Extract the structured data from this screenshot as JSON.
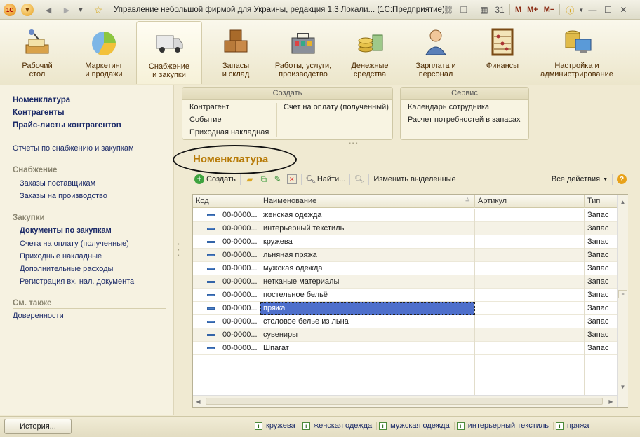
{
  "window": {
    "title": "Управление небольшой фирмой для Украины, редакция 1.3 Локали...  (1С:Предприятие)",
    "memory_buttons": [
      "M",
      "M+",
      "M−"
    ]
  },
  "sections": [
    {
      "label": "Рабочий\nстол",
      "icon": "desk-icon"
    },
    {
      "label": "Маркетинг\nи продажи",
      "icon": "pie-chart-icon"
    },
    {
      "label": "Снабжение\nи закупки",
      "icon": "truck-icon"
    },
    {
      "label": "Запасы\nи склад",
      "icon": "boxes-icon"
    },
    {
      "label": "Работы, услуги,\nпроизводство",
      "icon": "toolbox-icon"
    },
    {
      "label": "Денежные\nсредства",
      "icon": "coins-icon"
    },
    {
      "label": "Зарплата и\nперсонал",
      "icon": "person-icon"
    },
    {
      "label": "Финансы",
      "icon": "abacus-icon"
    },
    {
      "label": "Настройка и\nадминистрирование",
      "icon": "computer-icon"
    }
  ],
  "nav": {
    "top": [
      "Номенклатура",
      "Контрагенты",
      "Прайс-листы контрагентов"
    ],
    "reports": "Отчеты по снабжению и закупкам",
    "supply_header": "Снабжение",
    "supply": [
      "Заказы поставщикам",
      "Заказы на производство"
    ],
    "purchases_header": "Закупки",
    "purchases": [
      "Документы по закупкам",
      "Счета на оплату (полученные)",
      "Приходные накладные",
      "Дополнительные расходы",
      "Регистрация вх. нал. документа"
    ],
    "see_also_header": "См. также",
    "see_also": [
      "Доверенности"
    ]
  },
  "create_box": {
    "title": "Создать",
    "items": [
      "Контрагент",
      "Событие",
      "Приходная накладная",
      "Счет на оплату (полученный)"
    ]
  },
  "service_box": {
    "title": "Сервис",
    "items": [
      "Календарь сотрудника",
      "Расчет потребностей в запасах"
    ]
  },
  "form": {
    "title": "Номенклатура"
  },
  "toolbar": {
    "create": "Создать",
    "find": "Найти...",
    "change_selected": "Изменить выделенные",
    "all_actions": "Все действия"
  },
  "table": {
    "columns": [
      "Код",
      "Наименование",
      "Артикул",
      "Тип"
    ],
    "rows": [
      {
        "code": "00-0000...",
        "name": "женская одежда",
        "article": "",
        "type": "Запас"
      },
      {
        "code": "00-0000...",
        "name": "интерьерный текстиль",
        "article": "",
        "type": "Запас"
      },
      {
        "code": "00-0000...",
        "name": "кружева",
        "article": "",
        "type": "Запас"
      },
      {
        "code": "00-0000...",
        "name": "льняная пряжа",
        "article": "",
        "type": "Запас"
      },
      {
        "code": "00-0000...",
        "name": "мужская одежда",
        "article": "",
        "type": "Запас"
      },
      {
        "code": "00-0000...",
        "name": "нетканые материалы",
        "article": "",
        "type": "Запас"
      },
      {
        "code": "00-0000...",
        "name": "постельное бельё",
        "article": "",
        "type": "Запас"
      },
      {
        "code": "00-0000...",
        "name": "пряжа",
        "article": "",
        "type": "Запас"
      },
      {
        "code": "00-0000...",
        "name": "столовое белье из льна",
        "article": "",
        "type": "Запас"
      },
      {
        "code": "00-0000...",
        "name": "сувениры",
        "article": "",
        "type": "Запас"
      },
      {
        "code": "00-0000...",
        "name": "Шпагат",
        "article": "",
        "type": "Запас"
      }
    ],
    "selected_index": 7
  },
  "status": {
    "history_button": "История...",
    "history_links": [
      "кружева",
      "женская одежда",
      "мужская одежда",
      "интерьерный текстиль",
      "пряжа"
    ]
  }
}
